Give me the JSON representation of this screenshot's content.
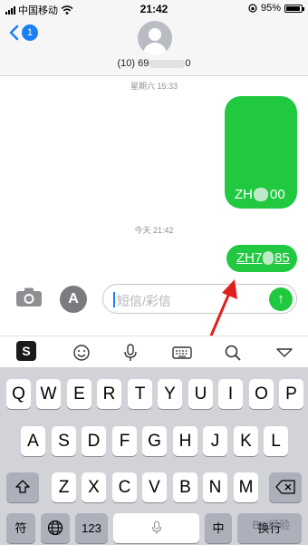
{
  "status_bar": {
    "carrier": "中国移动",
    "time": "21:42",
    "battery_percent": "95%",
    "battery_level": 0.95
  },
  "header": {
    "back_badge": "1",
    "contact_prefix": "(10) 69",
    "contact_suffix": "0"
  },
  "messages": {
    "stamp_1": "星期六 15:33",
    "bubble_1_left": "ZH",
    "bubble_1_right": "00",
    "stamp_2": "今天 21:42",
    "bubble_2_left": "ZH7",
    "bubble_2_right": "85"
  },
  "compose": {
    "placeholder": "短信/彩信",
    "send_glyph": "↑",
    "app_store_glyph": "A"
  },
  "keyboard": {
    "row1": [
      "Q",
      "W",
      "E",
      "R",
      "T",
      "Y",
      "U",
      "I",
      "O",
      "P"
    ],
    "row2": [
      "A",
      "S",
      "D",
      "F",
      "G",
      "H",
      "J",
      "K",
      "L"
    ],
    "row3": [
      "Z",
      "X",
      "C",
      "V",
      "B",
      "N",
      "M"
    ],
    "symbol_key": "符",
    "numbers_key": "123",
    "lang_key": "中",
    "return_key": "换行",
    "watermark": "Bai经验"
  }
}
